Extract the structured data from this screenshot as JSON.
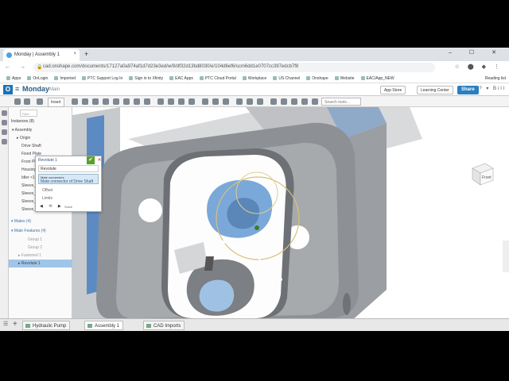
{
  "browser": {
    "tab_title": "Monday | Assembly 1",
    "tab_close": "×",
    "new_tab": "+",
    "window_controls": "– ☐ ✕",
    "nav_icons": "← → ⟳",
    "url": "cad.onshape.com/documents/17127a0a974af1d7d23e3ed/w/9/df32d13bd8030/e/104d6ef6/scm6dd1e0707cc397edcb7f8",
    "extensions": "☆ ⬤ ◆ ⋮",
    "bookmarks": [
      "Apps",
      "OnLogin",
      "Imported",
      "PTC Support Log In",
      "Sign in to Xfinity",
      "EAC Apps",
      "PTC Cloud Portal",
      "Workplace",
      "US Channel",
      "Onshape",
      "Website",
      "EAC/App_NEW"
    ],
    "reading_list": "Reading list"
  },
  "onshape": {
    "logo": "O",
    "menu_icon": "≡",
    "document_name": "Monday",
    "workspace": "Main",
    "app_store": "App Store",
    "learning_center": "Learning Center",
    "share": "Share",
    "top_icons": "? ▾ Bill",
    "insert": "Insert",
    "search_tools": "Search tools..."
  },
  "panel": {
    "header": "Instances (8)",
    "filter_placeholder": "Filter",
    "items": [
      {
        "label": "▾ Assembly",
        "indent": 4
      },
      {
        "label": "▸ Origin",
        "indent": 10
      },
      {
        "label": "Drive Shaft",
        "indent": 14
      },
      {
        "label": "Fixed Plate",
        "indent": 14
      },
      {
        "label": "Front Plate",
        "indent": 14
      },
      {
        "label": "Housing <1>",
        "indent": 14
      },
      {
        "label": "Idler <1>",
        "indent": 14
      },
      {
        "label": "Sleeve_1 <1>",
        "indent": 14
      },
      {
        "label": "Sleeve_1 <2>",
        "indent": 14
      },
      {
        "label": "Sleeve_1 <3>",
        "indent": 14
      },
      {
        "label": "Sleeve_1 <1>",
        "indent": 14
      }
    ],
    "mates_header": "▾ Mates (4)",
    "mate_features_header": "▾ Mate Features (4)",
    "mate_items": [
      {
        "label": "Group 1",
        "indent": 14
      },
      {
        "label": "Group 2",
        "indent": 14
      },
      {
        "label": "▸ Fastened 1",
        "indent": 10
      },
      {
        "label": "▸ Revolute 1",
        "indent": 10
      }
    ]
  },
  "dialog": {
    "title": "Revolute 1",
    "ok": "✔",
    "cancel": "✕",
    "type": "Revolute",
    "field_label": "Mate connectors",
    "field_value": "Mate connector of Drive Shaft",
    "offset": "Offset",
    "limits": "Limits",
    "solve_icons": "◀ ⟲ ▶",
    "solve": "Solve"
  },
  "viewcube": {
    "face": "Front"
  },
  "bottom": {
    "menu_icon": "☰",
    "add": "+",
    "tabs": [
      "Hydraulic Pump",
      "Assembly 1",
      "CAD Imports"
    ]
  }
}
